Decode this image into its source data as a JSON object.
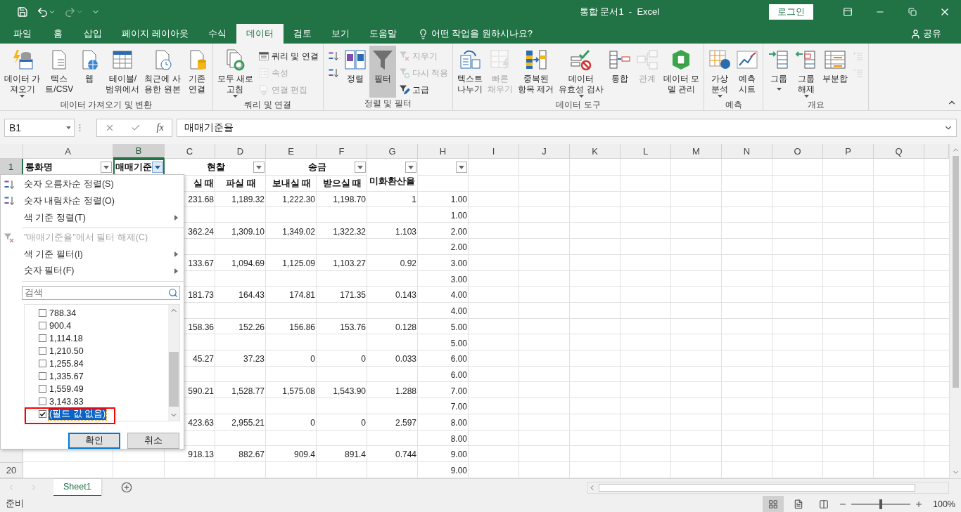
{
  "window": {
    "title": "통합 문서1  -  Excel",
    "sign_in": "로그인"
  },
  "tabs": [
    {
      "label": "파일",
      "selected": false
    },
    {
      "label": "홈",
      "selected": false
    },
    {
      "label": "삽입",
      "selected": false
    },
    {
      "label": "페이지 레이아웃",
      "selected": false
    },
    {
      "label": "수식",
      "selected": false
    },
    {
      "label": "데이터",
      "selected": true
    },
    {
      "label": "검토",
      "selected": false
    },
    {
      "label": "보기",
      "selected": false
    },
    {
      "label": "도움말",
      "selected": false
    }
  ],
  "tell_me": "어떤 작업을 원하시나요?",
  "share": "공유",
  "ribbon": {
    "groups": [
      {
        "label": "데이터 가져오기 및 변환",
        "controls": [
          {
            "kind": "large",
            "lines": [
              "데이터 가",
              "져오기"
            ],
            "caret": true,
            "disabled": false,
            "pressed": false
          },
          {
            "kind": "large",
            "lines": [
              "텍스",
              "트/CSV"
            ],
            "caret": false,
            "disabled": false,
            "pressed": false
          },
          {
            "kind": "large",
            "lines": [
              "웹"
            ],
            "caret": false,
            "disabled": false,
            "pressed": false
          },
          {
            "kind": "large",
            "lines": [
              "테이블/",
              "범위에서"
            ],
            "caret": false,
            "disabled": false,
            "pressed": false
          },
          {
            "kind": "large",
            "lines": [
              "최근에 사",
              "용한 원본"
            ],
            "caret": false,
            "disabled": false,
            "pressed": false
          },
          {
            "kind": "large",
            "lines": [
              "기존",
              "연결"
            ],
            "caret": false,
            "disabled": false,
            "pressed": false
          }
        ]
      },
      {
        "label": "쿼리 및 연결",
        "controls": [
          {
            "kind": "large",
            "lines": [
              "모두 새로",
              "고침"
            ],
            "caret": true,
            "disabled": false,
            "pressed": false
          },
          {
            "kind": "stack",
            "items": [
              {
                "label": "쿼리 및 연결",
                "disabled": false
              },
              {
                "label": "속성",
                "disabled": true
              },
              {
                "label": "연결 편집",
                "disabled": true
              }
            ]
          }
        ]
      },
      {
        "label": "정렬 및 필터",
        "controls": [
          {
            "kind": "stack",
            "items": [
              {
                "disabled": false
              },
              {
                "disabled": false
              }
            ]
          },
          {
            "kind": "large",
            "lines": [
              "정렬"
            ],
            "caret": false,
            "disabled": false,
            "pressed": false
          },
          {
            "kind": "large",
            "lines": [
              "필터"
            ],
            "caret": false,
            "disabled": false,
            "pressed": true
          },
          {
            "kind": "stack",
            "items": [
              {
                "label": "지우기",
                "disabled": true
              },
              {
                "label": "다시 적용",
                "disabled": true
              },
              {
                "label": "고급",
                "disabled": false
              }
            ]
          }
        ]
      },
      {
        "label": "데이터 도구",
        "controls": [
          {
            "kind": "large",
            "lines": [
              "텍스트",
              "나누기"
            ],
            "caret": false,
            "disabled": false,
            "pressed": false
          },
          {
            "kind": "large",
            "lines": [
              "빠른",
              "채우기"
            ],
            "caret": false,
            "disabled": true,
            "pressed": false
          },
          {
            "kind": "large",
            "lines": [
              "중복된",
              "항목 제거"
            ],
            "caret": false,
            "disabled": false,
            "pressed": false
          },
          {
            "kind": "large",
            "lines": [
              "데이터",
              "유효성 검사"
            ],
            "caret": true,
            "disabled": false,
            "pressed": false
          },
          {
            "kind": "large",
            "lines": [
              "통합"
            ],
            "caret": false,
            "disabled": false,
            "pressed": false
          },
          {
            "kind": "large",
            "lines": [
              "관계"
            ],
            "caret": false,
            "disabled": true,
            "pressed": false
          },
          {
            "kind": "large",
            "lines": [
              "데이터 모",
              "델 관리"
            ],
            "caret": false,
            "disabled": false,
            "pressed": false
          }
        ]
      },
      {
        "label": "예측",
        "controls": [
          {
            "kind": "large",
            "lines": [
              "가상",
              "분석"
            ],
            "caret": true,
            "disabled": false,
            "pressed": false
          },
          {
            "kind": "large",
            "lines": [
              "예측",
              "시트"
            ],
            "caret": false,
            "disabled": false,
            "pressed": false
          }
        ]
      },
      {
        "label": "개요",
        "controls": [
          {
            "kind": "large",
            "lines": [
              "그룹"
            ],
            "caret": true,
            "disabled": false,
            "pressed": false
          },
          {
            "kind": "large",
            "lines": [
              "그룹",
              "해제"
            ],
            "caret": true,
            "disabled": false,
            "pressed": false
          },
          {
            "kind": "large",
            "lines": [
              "부분합"
            ],
            "caret": false,
            "disabled": false,
            "pressed": false
          },
          {
            "kind": "stack",
            "items": [
              {
                "disabled": true
              },
              {
                "disabled": true
              }
            ]
          }
        ]
      }
    ]
  },
  "formula_bar": {
    "name_box": "B1",
    "insert_function": "fx",
    "formula": "매매기준율"
  },
  "sheet": {
    "columns": [
      {
        "label": "A",
        "selected": false
      },
      {
        "label": "B",
        "selected": true
      },
      {
        "label": "C",
        "selected": false
      },
      {
        "label": "D",
        "selected": false
      },
      {
        "label": "E",
        "selected": false
      },
      {
        "label": "F",
        "selected": false
      },
      {
        "label": "G",
        "selected": false
      },
      {
        "label": "H",
        "selected": false
      },
      {
        "label": "I",
        "selected": false
      },
      {
        "label": "J",
        "selected": false
      },
      {
        "label": "K",
        "selected": false
      },
      {
        "label": "L",
        "selected": false
      },
      {
        "label": "M",
        "selected": false
      },
      {
        "label": "N",
        "selected": false
      },
      {
        "label": "O",
        "selected": false
      },
      {
        "label": "P",
        "selected": false
      },
      {
        "label": "Q",
        "selected": false
      }
    ],
    "row_headers": [
      {
        "label": "1",
        "selected": true
      },
      {
        "label": "20",
        "selected": false
      }
    ],
    "header_row_1": [
      {
        "text": "통화명",
        "filter": true,
        "open": false
      },
      {
        "text": "매매기준",
        "filter": true,
        "open": true
      },
      {
        "text": "현찰",
        "filter": true,
        "open": false
      },
      {
        "text": "송금",
        "filter": true,
        "open": false
      },
      {
        "text": "미화환산율",
        "filter": true,
        "open": false
      },
      {
        "filter": true,
        "open": false
      }
    ],
    "header_row_2": [
      "실 때",
      "파실 때",
      "보내실 때",
      "받으실 때"
    ],
    "rows": [
      {
        "c": "231.68",
        "d": "1,189.32",
        "e": "1,222.30",
        "f": "1,198.70",
        "g": "1",
        "h": "1.00"
      },
      {
        "h": "1.00"
      },
      {
        "c": "362.24",
        "d": "1,309.10",
        "e": "1,349.02",
        "f": "1,322.32",
        "g": "1.103",
        "h": "2.00"
      },
      {
        "h": "2.00"
      },
      {
        "c": "133.67",
        "d": "1,094.69",
        "e": "1,125.09",
        "f": "1,103.27",
        "g": "0.92",
        "h": "3.00"
      },
      {
        "h": "3.00"
      },
      {
        "c": "181.73",
        "d": "164.43",
        "e": "174.81",
        "f": "171.35",
        "g": "0.143",
        "h": "4.00"
      },
      {
        "h": "4.00"
      },
      {
        "c": "158.36",
        "d": "152.26",
        "e": "156.86",
        "f": "153.76",
        "g": "0.128",
        "h": "5.00"
      },
      {
        "h": "5.00"
      },
      {
        "c": "45.27",
        "d": "37.23",
        "e": "0",
        "f": "0",
        "g": "0.033",
        "h": "6.00"
      },
      {
        "h": "6.00"
      },
      {
        "c": "590.21",
        "d": "1,528.77",
        "e": "1,575.08",
        "f": "1,543.90",
        "g": "1.288",
        "h": "7.00"
      },
      {
        "h": "7.00"
      },
      {
        "c": "423.63",
        "d": "2,955.21",
        "e": "0",
        "f": "0",
        "g": "2.597",
        "h": "8.00"
      },
      {
        "h": "8.00"
      },
      {
        "c": "918.13",
        "d": "882.67",
        "e": "909.4",
        "f": "891.4",
        "g": "0.744",
        "h": "9.00"
      },
      {
        "h": "9.00"
      }
    ]
  },
  "filter_menu": {
    "sections": [
      [
        {
          "kind": "sort-asc",
          "label": "숫자 오름차순 정렬(S)",
          "disabled": false,
          "submenu": false
        },
        {
          "kind": "sort-desc",
          "label": "숫자 내림차순 정렬(O)",
          "disabled": false,
          "submenu": false
        },
        {
          "kind": "plain",
          "label": "색 기준 정렬(T)",
          "disabled": false,
          "submenu": true
        }
      ],
      [
        {
          "kind": "clear",
          "label": "\"매매기준율\"에서 필터 해제(C)",
          "disabled": true,
          "submenu": false
        },
        {
          "kind": "plain",
          "label": "색 기준 필터(I)",
          "disabled": false,
          "submenu": true
        },
        {
          "kind": "plain",
          "label": "숫자 필터(F)",
          "disabled": false,
          "submenu": true
        }
      ]
    ],
    "search": {
      "placeholder": "검색"
    },
    "values": [
      {
        "label": "788.34",
        "checked": false,
        "selected": false
      },
      {
        "label": "900.4",
        "checked": false,
        "selected": false
      },
      {
        "label": "1,114.18",
        "checked": false,
        "selected": false
      },
      {
        "label": "1,210.50",
        "checked": false,
        "selected": false
      },
      {
        "label": "1,255.84",
        "checked": false,
        "selected": false
      },
      {
        "label": "1,335.67",
        "checked": false,
        "selected": false
      },
      {
        "label": "1,559.49",
        "checked": false,
        "selected": false
      },
      {
        "label": "3,143.83",
        "checked": false,
        "selected": false
      },
      {
        "label": "(필드 값 없음)",
        "checked": true,
        "selected": true
      }
    ],
    "buttons": [
      {
        "label": "확인",
        "focused": true
      },
      {
        "label": "취소",
        "focused": false
      }
    ]
  },
  "sheet_tabs": [
    {
      "label": "Sheet1",
      "selected": true
    }
  ],
  "status_bar": {
    "status": "준비",
    "views": [
      {
        "selected": true
      },
      {
        "selected": false
      },
      {
        "selected": false
      }
    ],
    "zoom": {
      "level": 0.5,
      "reading": "100%"
    }
  }
}
